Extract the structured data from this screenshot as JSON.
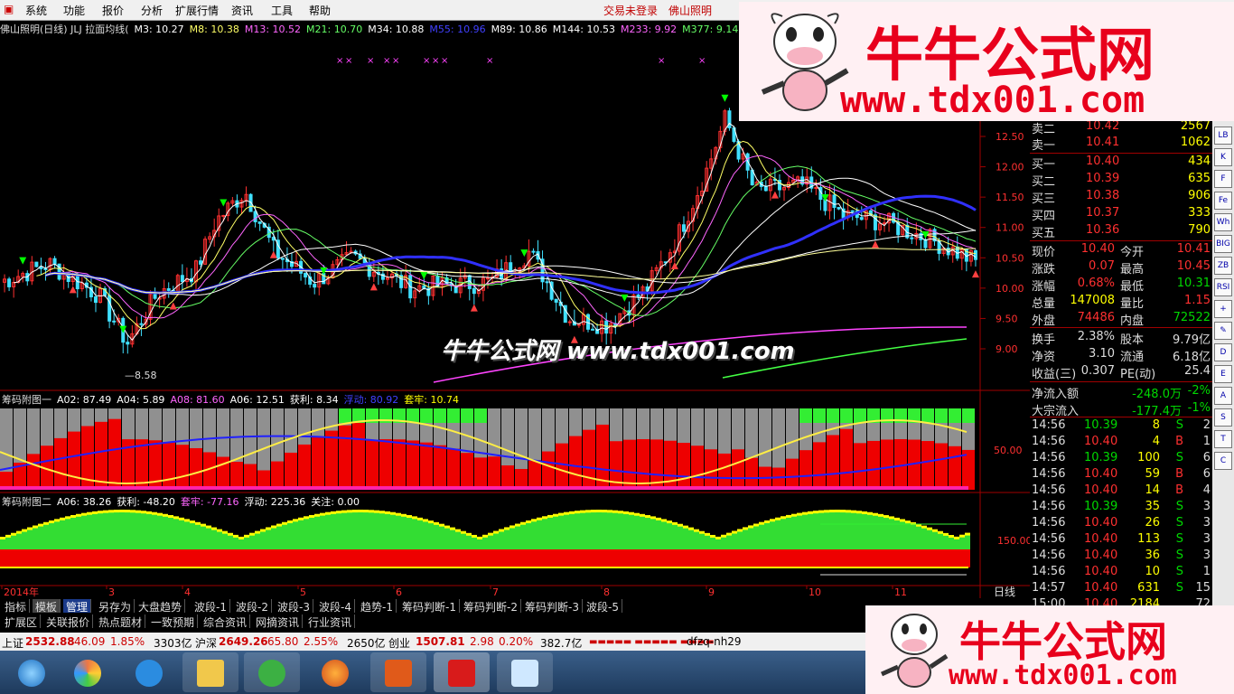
{
  "menu": {
    "items": [
      "系统",
      "功能",
      "报价",
      "分析",
      "扩展行情",
      "资讯",
      "工具",
      "帮助"
    ],
    "trade_status": "交易未登录",
    "stock_name": "佛山照明"
  },
  "chart_header": {
    "name": "佛山照明(日线) JLJ 拉面均线(",
    "ma": [
      {
        "label": "M3: 10.27",
        "color": "#ffffff"
      },
      {
        "label": "M8: 10.38",
        "color": "#ffff66"
      },
      {
        "label": "M13: 10.52",
        "color": "#ff66ff"
      },
      {
        "label": "M21: 10.70",
        "color": "#66ff66"
      },
      {
        "label": "M34: 10.88",
        "color": "#ffffff"
      },
      {
        "label": "M55: 10.96",
        "color": "#4040ff"
      },
      {
        "label": "M89: 10.86",
        "color": "#ffffff"
      },
      {
        "label": "M144: 10.53",
        "color": "#ffffff"
      },
      {
        "label": "M233: 9.92",
        "color": "#ff66ff"
      },
      {
        "label": "M377: 9.14",
        "color": "#66ff66"
      }
    ]
  },
  "main_chart": {
    "y_ticks": [
      "12.50",
      "12.00",
      "11.50",
      "11.00",
      "10.50",
      "10.00",
      "9.50",
      "9.00"
    ],
    "low_label": "8.58",
    "x_labels": [
      "2014年",
      "3",
      "4",
      "5",
      "6",
      "7",
      "8",
      "9",
      "10",
      "11"
    ],
    "period": "日线"
  },
  "sub1": {
    "title": "筹码附图一",
    "vals": [
      {
        "label": "A02: 87.49",
        "color": "#ffffff"
      },
      {
        "label": "A04: 5.89",
        "color": "#ffffff"
      },
      {
        "label": "A08: 81.60",
        "color": "#ff66ff"
      },
      {
        "label": "A06: 12.51",
        "color": "#ffffff"
      },
      {
        "label": "获利: 8.34",
        "color": "#ffffff"
      },
      {
        "label": "浮动: 80.92",
        "color": "#4040ff"
      },
      {
        "label": "套牢: 10.74",
        "color": "#ffff00"
      }
    ],
    "y_tick": "50.00"
  },
  "sub2": {
    "title": "筹码附图二",
    "vals": [
      {
        "label": "A06: 38.26",
        "color": "#ffffff"
      },
      {
        "label": "获利: -48.20",
        "color": "#ffffff"
      },
      {
        "label": "套牢: -77.16",
        "color": "#ff66ff"
      },
      {
        "label": "浮动: 225.36",
        "color": "#ffffff"
      },
      {
        "label": "关注: 0.00",
        "color": "#ffffff"
      }
    ],
    "y_tick": "150.00"
  },
  "orderbook": {
    "sell": [
      {
        "label": "卖二",
        "price": "10.42",
        "vol": "2567"
      },
      {
        "label": "卖一",
        "price": "10.41",
        "vol": "1062"
      }
    ],
    "buy": [
      {
        "label": "买一",
        "price": "10.40",
        "vol": "434"
      },
      {
        "label": "买二",
        "price": "10.39",
        "vol": "635"
      },
      {
        "label": "买三",
        "price": "10.38",
        "vol": "906"
      },
      {
        "label": "买四",
        "price": "10.37",
        "vol": "333"
      },
      {
        "label": "买五",
        "price": "10.36",
        "vol": "790"
      }
    ]
  },
  "quote": [
    {
      "l1": "现价",
      "v1": "10.40",
      "c1": "red",
      "l2": "今开",
      "v2": "10.41",
      "c2": "red"
    },
    {
      "l1": "涨跌",
      "v1": "0.07",
      "c1": "red",
      "l2": "最高",
      "v2": "10.45",
      "c2": "red"
    },
    {
      "l1": "涨幅",
      "v1": "0.68%",
      "c1": "red",
      "l2": "最低",
      "v2": "10.31",
      "c2": "green"
    },
    {
      "l1": "总量",
      "v1": "147008",
      "c1": "yellow",
      "l2": "量比",
      "v2": "1.15",
      "c2": "red"
    },
    {
      "l1": "外盘",
      "v1": "74486",
      "c1": "red",
      "l2": "内盘",
      "v2": "72522",
      "c2": "green"
    }
  ],
  "fundamentals": [
    {
      "l1": "换手",
      "v1": "2.38%",
      "l2": "股本",
      "v2": "9.79亿"
    },
    {
      "l1": "净资",
      "v1": "3.10",
      "l2": "流通",
      "v2": "6.18亿"
    },
    {
      "l1": "收益(三)",
      "v1": "0.307",
      "l2": "PE(动)",
      "v2": "25.4"
    }
  ],
  "flows": [
    {
      "label": "净流入额",
      "value": "-248.0万",
      "pct": "-2%"
    },
    {
      "label": "大宗流入",
      "value": "-177.4万",
      "pct": "-1%"
    }
  ],
  "ticks": [
    {
      "t": "14:56",
      "p": "10.39",
      "pc": "green",
      "v": "8",
      "s": "S",
      "n": "2"
    },
    {
      "t": "14:56",
      "p": "10.40",
      "pc": "red",
      "v": "4",
      "s": "B",
      "n": "1"
    },
    {
      "t": "14:56",
      "p": "10.39",
      "pc": "green",
      "v": "100",
      "s": "S",
      "n": "6"
    },
    {
      "t": "14:56",
      "p": "10.40",
      "pc": "red",
      "v": "59",
      "s": "B",
      "n": "6"
    },
    {
      "t": "14:56",
      "p": "10.40",
      "pc": "red",
      "v": "14",
      "s": "B",
      "n": "4"
    },
    {
      "t": "14:56",
      "p": "10.39",
      "pc": "green",
      "v": "35",
      "s": "S",
      "n": "3"
    },
    {
      "t": "14:56",
      "p": "10.40",
      "pc": "red",
      "v": "26",
      "s": "S",
      "n": "3"
    },
    {
      "t": "14:56",
      "p": "10.40",
      "pc": "red",
      "v": "113",
      "s": "S",
      "n": "3"
    },
    {
      "t": "14:56",
      "p": "10.40",
      "pc": "red",
      "v": "36",
      "s": "S",
      "n": "3"
    },
    {
      "t": "14:56",
      "p": "10.40",
      "pc": "red",
      "v": "10",
      "s": "S",
      "n": "1"
    },
    {
      "t": "14:57",
      "p": "10.40",
      "pc": "red",
      "v": "631",
      "s": "S",
      "n": "15"
    },
    {
      "t": "15:00",
      "p": "10.40",
      "pc": "red",
      "v": "2184",
      "s": "",
      "n": "72"
    }
  ],
  "tabs_row1": [
    "指标",
    "模板",
    "管理",
    "另存为",
    "大盘趋势",
    "波段-1",
    "波段-2",
    "波段-3",
    "波段-4",
    "趋势-1",
    "筹码判断-1",
    "筹码判断-2",
    "筹码判断-3",
    "波段-5"
  ],
  "tabs_row2": [
    "扩展区",
    "关联报价",
    "热点题材",
    "一致预期",
    "综合资讯",
    "网摘资讯",
    "行业资讯"
  ],
  "status": {
    "sh_label": "上证",
    "sh_val": "2532.88",
    "sh_chg": "46.09",
    "sh_pct": "1.85%",
    "sh_amt": "3303亿",
    "sz_label": "沪深",
    "sz_val": "2649.26",
    "sz_chg": "65.80",
    "sz_pct": "2.55%",
    "sz_amt": "2650亿",
    "cy_label": "创业",
    "cy_val": "1507.81",
    "cy_chg": "2.98",
    "cy_pct": "0.20%",
    "cy_amt": "382.7亿",
    "user": "dfzq-nh29"
  },
  "watermark": {
    "title": "牛牛公式网",
    "url": "www.tdx001.com",
    "center": "牛牛公式网 www.tdx001.com"
  },
  "right_tools": [
    "LB",
    "K",
    "F",
    "Fe",
    "Wh",
    "BIG",
    "ZB",
    "RSI",
    "+",
    "✎",
    "D",
    "E",
    "A",
    "S",
    "T",
    "C"
  ]
}
